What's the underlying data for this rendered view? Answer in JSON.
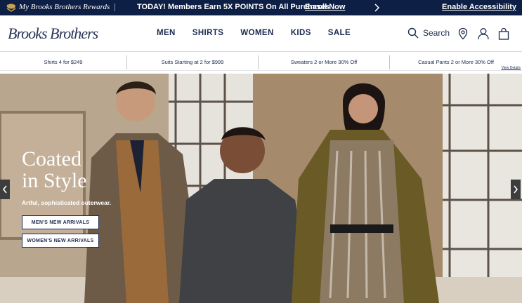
{
  "topbar": {
    "rewards_label": "My Brooks Brothers Rewards",
    "promo_text": "TODAY! Members Earn 5X POINTS On All Purchases",
    "enroll_label": "Enroll Now",
    "accessibility_label": "Enable Accessibility"
  },
  "header": {
    "logo_text": "Brooks Brothers",
    "nav": [
      {
        "label": "MEN"
      },
      {
        "label": "SHIRTS"
      },
      {
        "label": "WOMEN"
      },
      {
        "label": "KIDS"
      },
      {
        "label": "SALE"
      }
    ],
    "search_label": "Search"
  },
  "promos": [
    {
      "text": "Shirts 4 for $249"
    },
    {
      "text": "Suits Starting at 2 for $999"
    },
    {
      "text": "Sweaters 2 or More 30% Off"
    },
    {
      "text": "Casual Pants 2 or More 30% Off"
    }
  ],
  "view_details_label": "View Details",
  "hero": {
    "title_line1": "Coated",
    "title_line2": "in Style",
    "subtitle": "Artful, sophisticated outerwear.",
    "buttons": [
      {
        "label": "MEN'S NEW ARRIVALS"
      },
      {
        "label": "WOMEN'S NEW ARRIVALS"
      }
    ],
    "prev_icon": "chevron-left-icon",
    "next_icon": "chevron-right-icon"
  },
  "colors": {
    "navy": "#0e1f45",
    "text": "#1b2a4e"
  }
}
